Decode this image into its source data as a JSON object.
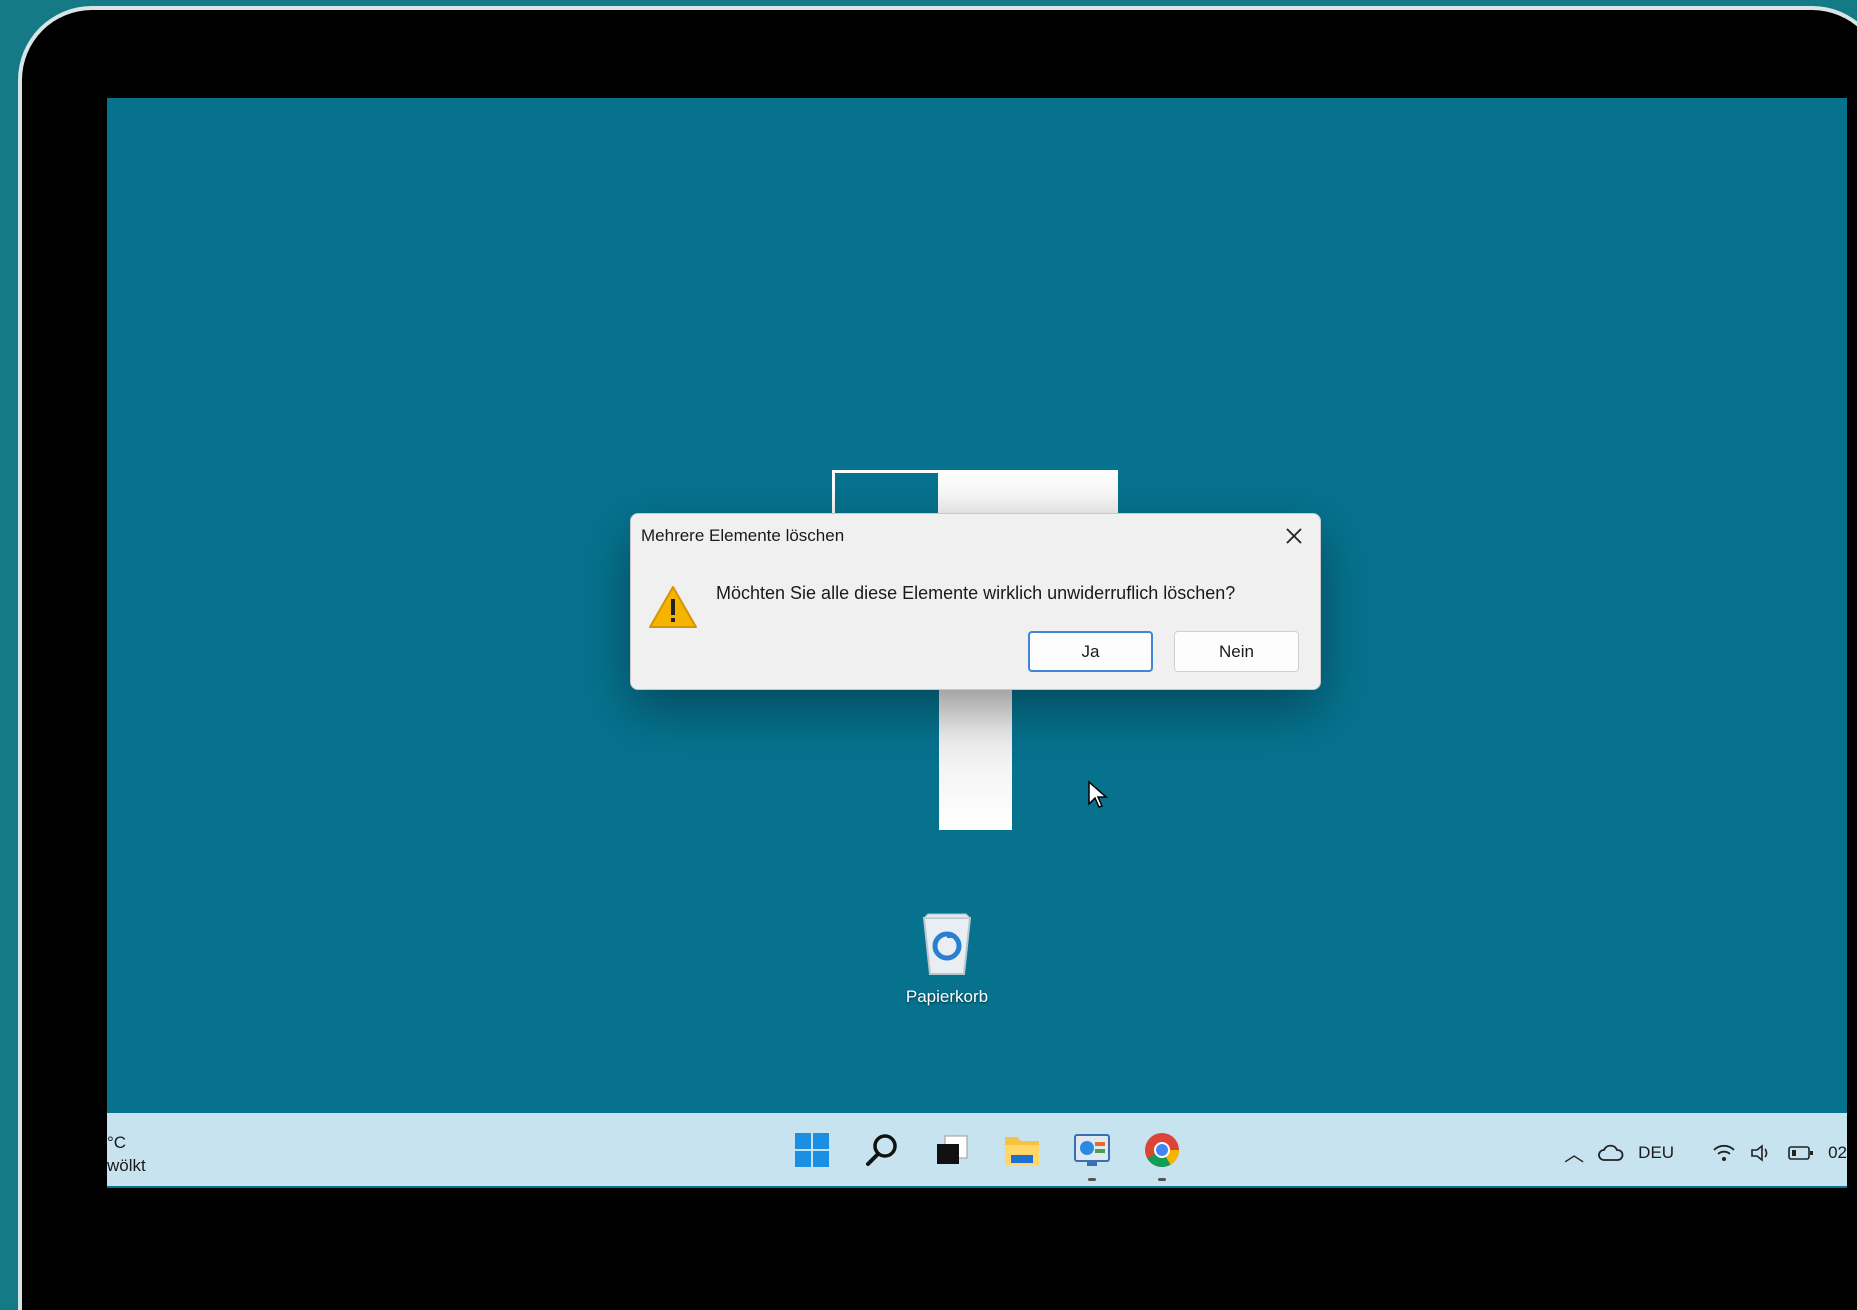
{
  "taskbar": {
    "weather_temp": "°C",
    "weather_desc": "wölkt",
    "icons": [
      "windows-start-icon",
      "search-icon",
      "task-view-icon",
      "file-explorer-icon",
      "control-panel-icon",
      "chrome-icon"
    ],
    "tray": {
      "language": "DEU",
      "clock": "02"
    }
  },
  "dialog": {
    "title": "Mehrere Elemente löschen",
    "message": "Möchten Sie alle diese Elemente wirklich unwiderruflich löschen?",
    "yes_label": "Ja",
    "no_label": "Nein"
  },
  "desktop": {
    "recycle_bin_label": "Papierkorb"
  },
  "colors": {
    "desktop": "#06728e",
    "taskbar": "#c7e3ef",
    "accent": "#3f86d6"
  }
}
